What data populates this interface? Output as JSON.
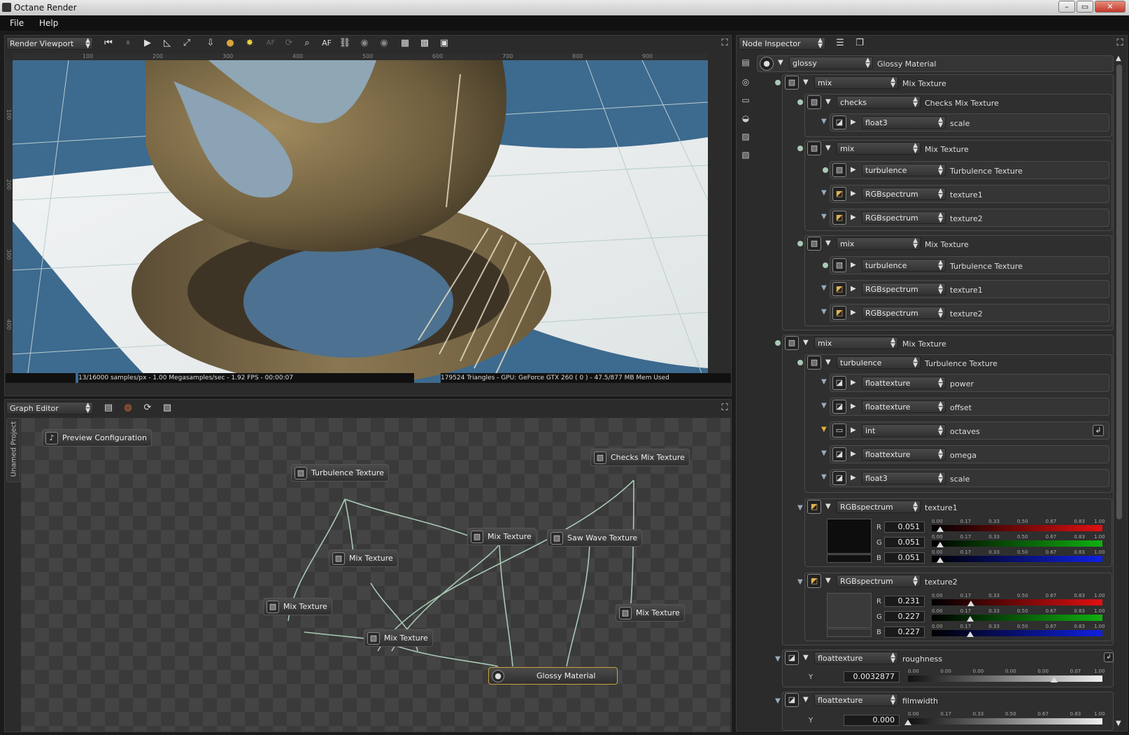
{
  "window": {
    "title": "Octane Render",
    "minimize": "–",
    "maximize": "▭",
    "close": "✕"
  },
  "menu": [
    "File",
    "Help"
  ],
  "viewport": {
    "panel_combo": "Render Viewport",
    "toolbar_icons": [
      "skip-start-icon",
      "pause-icon",
      "play-icon",
      "ruler-icon",
      "zoom-fit-icon",
      "pick-focus-icon",
      "material-pick-icon",
      "light-icon",
      "af-disabled-icon",
      "rotate-icon",
      "focus-pick-icon",
      "af-icon",
      "lock-icon",
      "camera-a-icon",
      "camera-b-icon",
      "grid-a-icon",
      "grid-b-icon",
      "grid-c-icon"
    ],
    "af_dim_label": "AF",
    "af_label": "AF",
    "ruler_top": [
      "100",
      "200",
      "300",
      "400",
      "500",
      "600",
      "700",
      "800",
      "900"
    ],
    "ruler_left": [
      "100",
      "200",
      "300",
      "400"
    ],
    "status_left": "13/16000 samples/px - 1.00 Megasamples/sec - 1.92 FPS - 00:00:07",
    "status_right": "179524 Triangles - GPU: GeForce GTX 260 ( 0 ) - 47.5/877 MB Mem Used"
  },
  "graph": {
    "panel_combo": "Graph Editor",
    "side_tab": "Unamed Project",
    "nodes": {
      "preview": "Preview Configuration",
      "turbulence": "Turbulence Texture",
      "checks": "Checks Mix Texture",
      "mix_a": "Mix Texture",
      "saw": "Saw Wave Texture",
      "mix_b": "Mix Texture",
      "mix_c": "Mix Texture",
      "mix_d": "Mix Texture",
      "mix_e": "Mix Texture",
      "glossy": "Glossy Material"
    }
  },
  "inspector": {
    "panel_combo": "Node Inspector",
    "root": {
      "type": "glossy",
      "name": "Glossy Material"
    },
    "mix1": {
      "type": "mix",
      "name": "Mix Texture"
    },
    "checks": {
      "type": "checks",
      "name": "Checks Mix Texture"
    },
    "checks_scale": {
      "type": "float3",
      "name": "scale"
    },
    "mix1a": {
      "type": "mix",
      "name": "Mix Texture"
    },
    "mix1a_rows": [
      {
        "type": "turbulence",
        "name": "Turbulence Texture"
      },
      {
        "type": "RGBspectrum",
        "name": "texture1"
      },
      {
        "type": "RGBspectrum",
        "name": "texture2"
      }
    ],
    "mix1b": {
      "type": "mix",
      "name": "Mix Texture"
    },
    "mix1b_rows": [
      {
        "type": "turbulence",
        "name": "Turbulence Texture"
      },
      {
        "type": "RGBspectrum",
        "name": "texture1"
      },
      {
        "type": "RGBspectrum",
        "name": "texture2"
      }
    ],
    "mix2": {
      "type": "mix",
      "name": "Mix Texture"
    },
    "turb": {
      "type": "turbulence",
      "name": "Turbulence Texture"
    },
    "turb_rows": [
      {
        "type": "floattexture",
        "name": "power"
      },
      {
        "type": "floattexture",
        "name": "offset"
      },
      {
        "type": "int",
        "name": "octaves"
      },
      {
        "type": "floattexture",
        "name": "omega"
      },
      {
        "type": "float3",
        "name": "scale"
      }
    ],
    "scale_labels": [
      "0.00",
      "0.17",
      "0.33",
      "0.50",
      "0.67",
      "0.83",
      "1.00"
    ],
    "tex1": {
      "type": "RGBspectrum",
      "name": "texture1",
      "R": "0.051",
      "G": "0.051",
      "B": "0.051",
      "r_value": 0.051,
      "g_value": 0.051,
      "b_value": 0.051
    },
    "tex2": {
      "type": "RGBspectrum",
      "name": "texture2",
      "R": "0.231",
      "G": "0.227",
      "B": "0.227",
      "r_value": 0.231,
      "g_value": 0.227,
      "b_value": 0.227
    },
    "channel_letters": [
      "R",
      "G",
      "B"
    ],
    "roughness": {
      "type": "floattexture",
      "name": "roughness",
      "axis": "Y",
      "value": "0.0032877",
      "scale": [
        "0.00",
        "0.00",
        "0.00",
        "0.00",
        "0.00",
        "0.07",
        "1.00"
      ],
      "slider_value": 0.75
    },
    "filmwidth": {
      "type": "floattexture",
      "name": "filmwidth",
      "axis": "Y",
      "value": "0.000",
      "scale": [
        "0.00",
        "0.17",
        "0.33",
        "0.50",
        "0.67",
        "0.83",
        "1.00"
      ],
      "slider_value": 0.0
    }
  },
  "colors": {
    "accent_select": "#c8a23b",
    "wire": "#a9c9b4",
    "red": "#e01010",
    "green": "#10b010",
    "blue": "#1020e0"
  }
}
